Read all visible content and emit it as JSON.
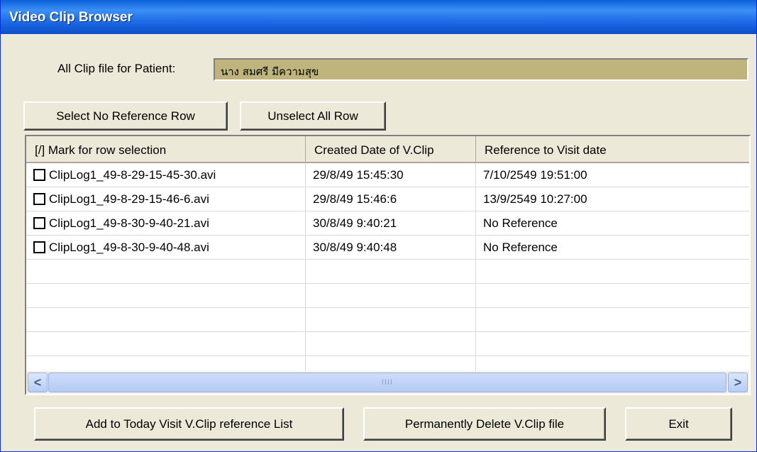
{
  "window": {
    "title": "Video Clip Browser"
  },
  "patient": {
    "label": "All Clip file for Patient:",
    "name": "นาง สมศรี มีความสุข"
  },
  "toolbar": {
    "select_no_ref": "Select No Reference Row",
    "unselect_all": "Unselect All Row"
  },
  "table": {
    "columns": [
      "[/] Mark for row selection",
      "Created Date of V.Clip",
      "Reference to Visit date"
    ],
    "rows": [
      {
        "file": "ClipLog1_49-8-29-15-45-30.avi",
        "created": "29/8/49 15:45:30",
        "reference": "7/10/2549 19:51:00",
        "checked": false
      },
      {
        "file": "ClipLog1_49-8-29-15-46-6.avi",
        "created": "29/8/49 15:46:6",
        "reference": "13/9/2549 10:27:00",
        "checked": false
      },
      {
        "file": "ClipLog1_49-8-30-9-40-21.avi",
        "created": "30/8/49 9:40:21",
        "reference": "No Reference",
        "checked": false
      },
      {
        "file": "ClipLog1_49-8-30-9-40-48.avi",
        "created": "30/8/49 9:40:48",
        "reference": "No Reference",
        "checked": false
      }
    ],
    "empty_row_count": 5
  },
  "scrollbar": {
    "left_arrow": "<",
    "right_arrow": ">",
    "thumb_grip": "IIII"
  },
  "footer": {
    "add_button": "Add to Today Visit V.Clip reference List",
    "delete_button": "Permanently Delete V.Clip file",
    "exit_button": "Exit"
  },
  "colors": {
    "titlebar": "#0a5fd8",
    "window_bg": "#ece9d8",
    "patient_field_bg": "#bfb47c"
  }
}
